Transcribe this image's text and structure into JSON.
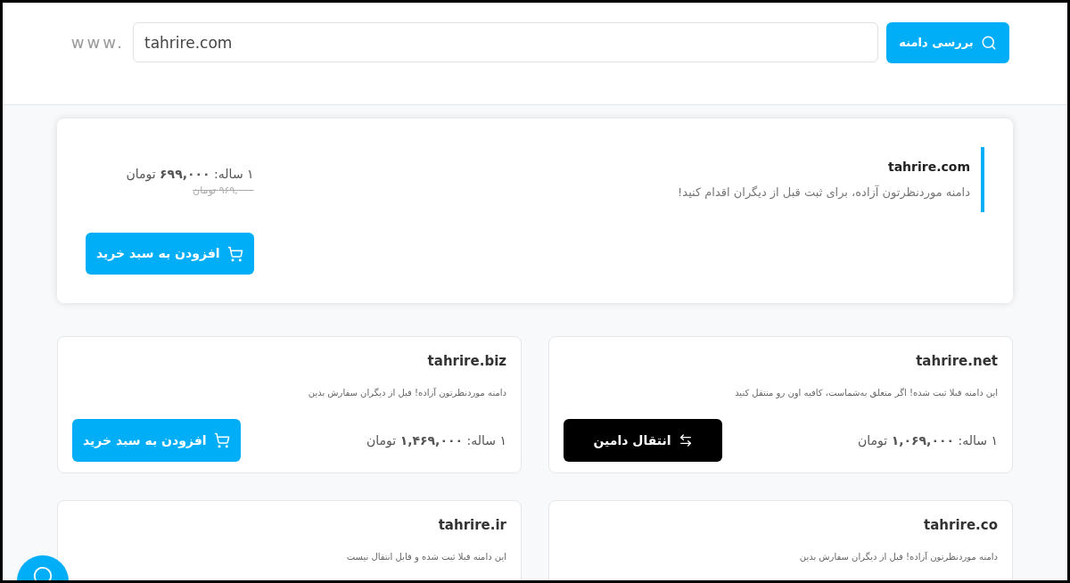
{
  "search": {
    "prefix": "www.",
    "value": "tahrire.com",
    "button": "بررسی دامنه"
  },
  "featured": {
    "domain": "tahrire.com",
    "message": "دامنه موردنظرتون آزاده، برای ثبت قبل از دیگران اقدام کنید!",
    "price": "۱ ساله: **۶۹۹,۰۰۰** تومان",
    "old_price": "۹۶۹,۰۰۰ تومان",
    "button": "افزودن به سبد خرید"
  },
  "results": [
    {
      "kind": "transfer",
      "domain": "tahrire.net",
      "message": "این دامنه قبلا ثبت شده! اگر متعلق به‌شماست، کافیه اون رو منتقل کنید",
      "price": "۱ ساله: **۱,۰۶۹,۰۰۰** تومان",
      "button": "انتقال دامین"
    },
    {
      "kind": "available",
      "domain": "tahrire.biz",
      "message": "دامنه موردنظرتون آزاده! قبل از دیگران سفارش بدین",
      "price": "۱ ساله: **۱,۴۶۹,۰۰۰** تومان",
      "button": "افزودن به سبد خرید"
    },
    {
      "kind": "available",
      "domain": "tahrire.co",
      "message": "دامنه موردنظرتون آزاده! قبل از دیگران سفارش بدین"
    },
    {
      "kind": "taken",
      "domain": "tahrire.ir",
      "message": "این دامنه قبلا ثبت شده و قابل انتقال نیست"
    }
  ]
}
